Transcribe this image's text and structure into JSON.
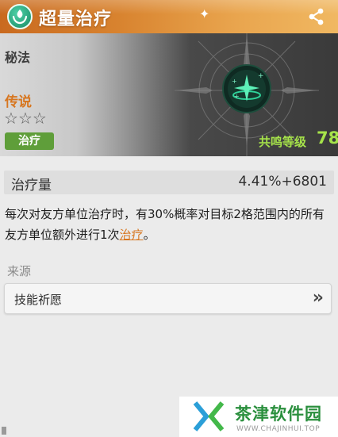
{
  "header": {
    "title": "超量治疗"
  },
  "card": {
    "type_label": "秘法",
    "rarity_label": "传说",
    "stars": [
      "☆",
      "☆",
      "☆"
    ],
    "stars_filled": 0,
    "tag_label": "治疗",
    "resonance_label": "共鸣等级",
    "resonance_value": "78"
  },
  "stat": {
    "label": "治疗量",
    "value": "4.41%+6801"
  },
  "description": {
    "text": "每次对友方单位治疗时，有30%概率对目标2格范围内的所有友方单位额外进行1次",
    "highlight": "治疗",
    "suffix": "。"
  },
  "source": {
    "title": "来源",
    "item_label": "技能祈愿",
    "chevron": "»"
  },
  "watermark": {
    "name": "茶津软件园",
    "url": "WWW.CHAJINHUI.TOP"
  },
  "colors": {
    "accent_orange": "#d7761f",
    "resonance_green": "#a6e34a",
    "tag_green": "#5f9e3a",
    "icon_teal": "#1fa577"
  }
}
